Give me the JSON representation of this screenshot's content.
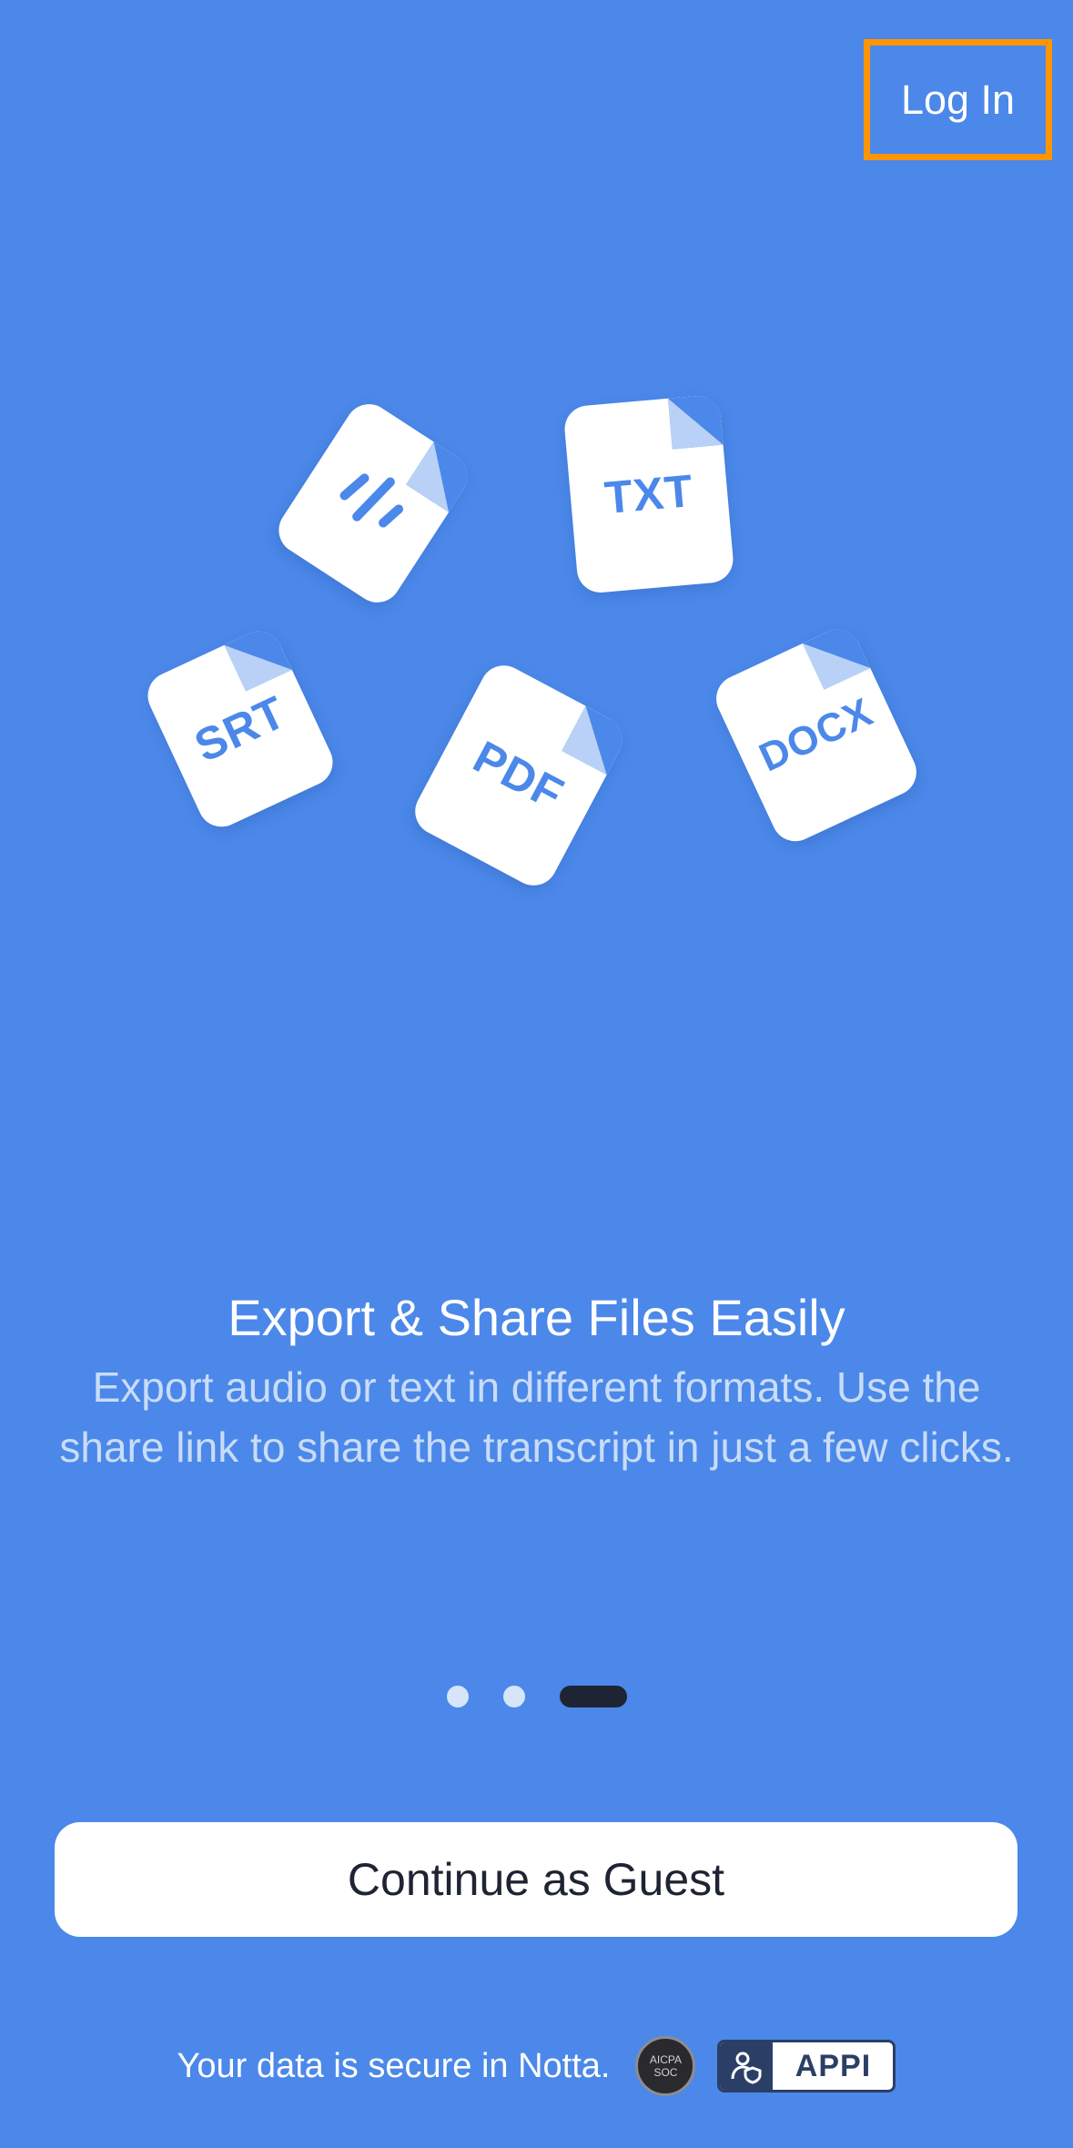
{
  "header": {
    "login_label": "Log In",
    "highlight_color": "#FF9500"
  },
  "illustration": {
    "documents": [
      {
        "kind": "audio",
        "label": ""
      },
      {
        "kind": "txt",
        "label": "TXT"
      },
      {
        "kind": "srt",
        "label": "SRT"
      },
      {
        "kind": "pdf",
        "label": "PDF"
      },
      {
        "kind": "docx",
        "label": "DOCX"
      }
    ]
  },
  "onboarding": {
    "title": "Export & Share Files Easily",
    "description": "Export audio or text in different formats. Use the share link to share the transcript in just a few clicks.",
    "page_count": 3,
    "active_page": 3
  },
  "actions": {
    "guest_label": "Continue as Guest"
  },
  "footer": {
    "secure_text": "Your data is secure in Notta.",
    "aicpa_line1": "AICPA",
    "aicpa_line2": "SOC",
    "appi_label": "APPI"
  },
  "colors": {
    "background": "#4B88E9",
    "button_text": "#1E2433",
    "active_dot": "#1E2433"
  }
}
